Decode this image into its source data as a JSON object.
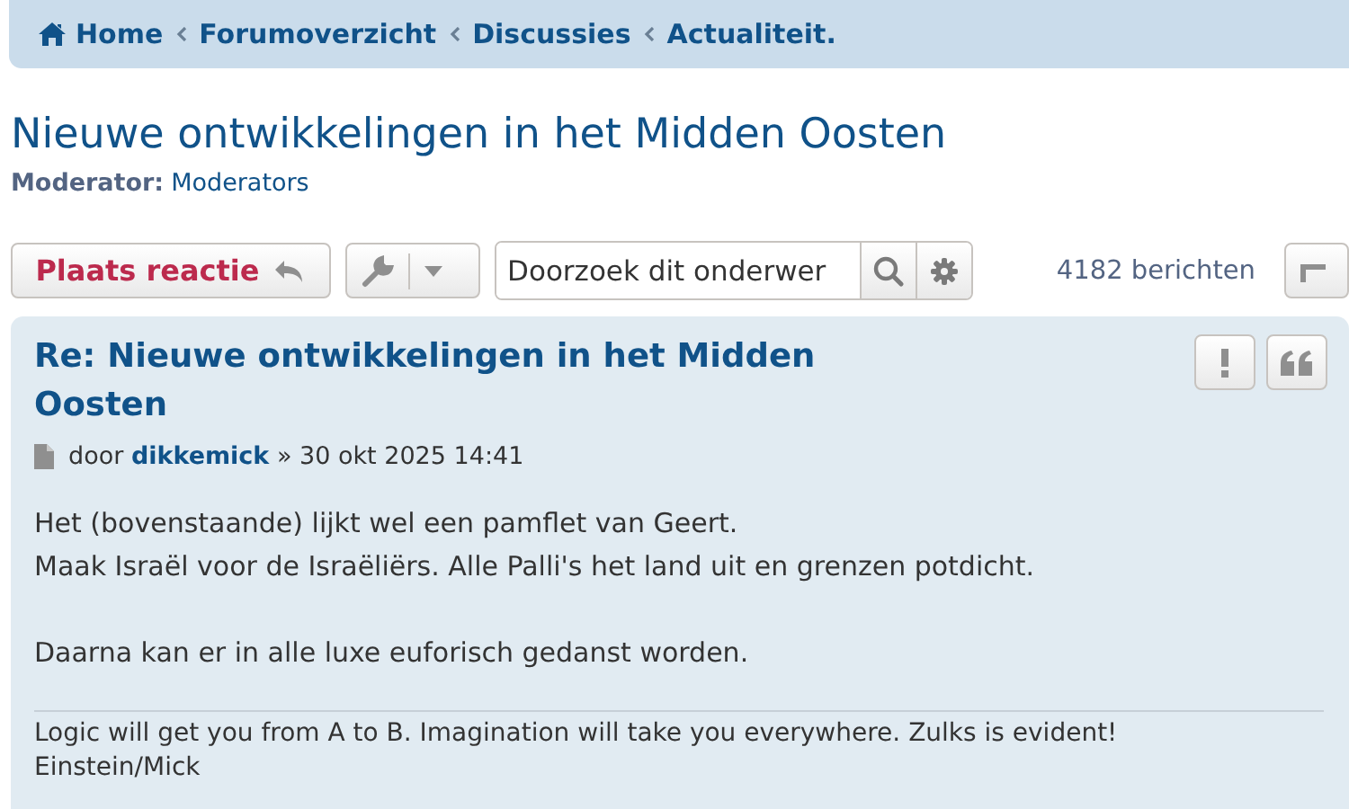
{
  "breadcrumbs": [
    {
      "label": "Home",
      "kind": "home"
    },
    {
      "label": "Forumoverzicht",
      "kind": "link"
    },
    {
      "label": "Discussies",
      "kind": "link"
    },
    {
      "label": "Actualiteit.",
      "kind": "link"
    }
  ],
  "topic": {
    "title": "Nieuwe ontwikkelingen in het Midden Oosten",
    "moderator_label": "Moderator:",
    "moderator": "Moderators"
  },
  "actions": {
    "reply_button": "Plaats reactie",
    "search": {
      "placeholder": "Doorzoek dit onderwer"
    },
    "post_count": "4182 berichten"
  },
  "post": {
    "title": "Re: Nieuwe ontwikkelingen in het Midden Oosten",
    "by": "door",
    "author": "dikkemick",
    "separator": "»",
    "date": "30 okt 2025 14:41",
    "paragraphs": [
      [
        "Het (bovenstaande) lijkt wel een pamflet van Geert.",
        "Maak Israël voor de Israëliërs. Alle Palli's het land uit en grenzen potdicht."
      ],
      [
        "Daarna kan er in alle luxe euforisch gedanst worden."
      ]
    ],
    "signature": [
      "Logic will get you from A to B. Imagination will take you everywhere. Zulks is evident!",
      "Einstein/Mick"
    ]
  }
}
